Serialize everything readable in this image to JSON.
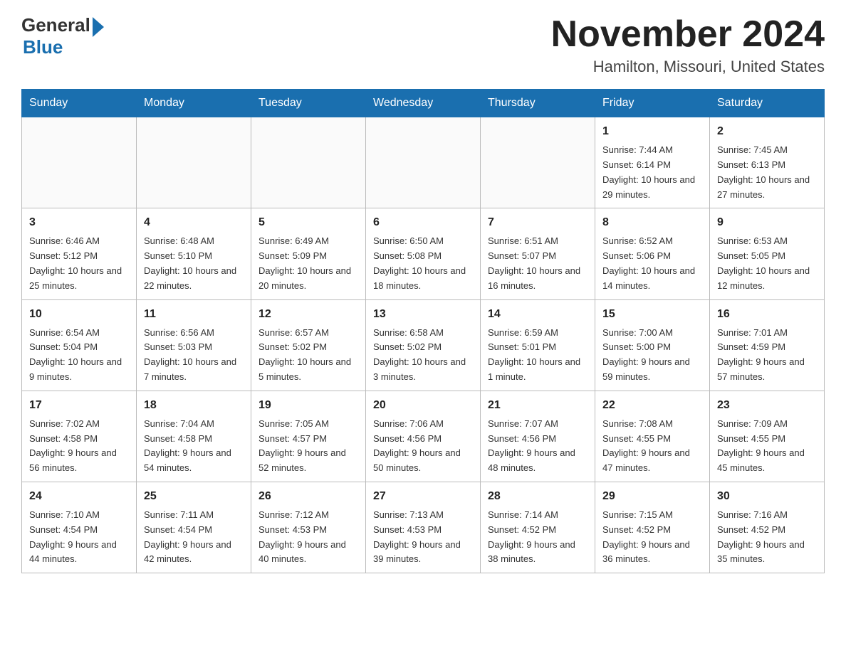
{
  "header": {
    "title": "November 2024",
    "subtitle": "Hamilton, Missouri, United States",
    "logo": {
      "general": "General",
      "blue": "Blue"
    }
  },
  "weekdays": [
    "Sunday",
    "Monday",
    "Tuesday",
    "Wednesday",
    "Thursday",
    "Friday",
    "Saturday"
  ],
  "weeks": [
    [
      {
        "day": "",
        "sunrise": "",
        "sunset": "",
        "daylight": ""
      },
      {
        "day": "",
        "sunrise": "",
        "sunset": "",
        "daylight": ""
      },
      {
        "day": "",
        "sunrise": "",
        "sunset": "",
        "daylight": ""
      },
      {
        "day": "",
        "sunrise": "",
        "sunset": "",
        "daylight": ""
      },
      {
        "day": "",
        "sunrise": "",
        "sunset": "",
        "daylight": ""
      },
      {
        "day": "1",
        "sunrise": "Sunrise: 7:44 AM",
        "sunset": "Sunset: 6:14 PM",
        "daylight": "Daylight: 10 hours and 29 minutes."
      },
      {
        "day": "2",
        "sunrise": "Sunrise: 7:45 AM",
        "sunset": "Sunset: 6:13 PM",
        "daylight": "Daylight: 10 hours and 27 minutes."
      }
    ],
    [
      {
        "day": "3",
        "sunrise": "Sunrise: 6:46 AM",
        "sunset": "Sunset: 5:12 PM",
        "daylight": "Daylight: 10 hours and 25 minutes."
      },
      {
        "day": "4",
        "sunrise": "Sunrise: 6:48 AM",
        "sunset": "Sunset: 5:10 PM",
        "daylight": "Daylight: 10 hours and 22 minutes."
      },
      {
        "day": "5",
        "sunrise": "Sunrise: 6:49 AM",
        "sunset": "Sunset: 5:09 PM",
        "daylight": "Daylight: 10 hours and 20 minutes."
      },
      {
        "day": "6",
        "sunrise": "Sunrise: 6:50 AM",
        "sunset": "Sunset: 5:08 PM",
        "daylight": "Daylight: 10 hours and 18 minutes."
      },
      {
        "day": "7",
        "sunrise": "Sunrise: 6:51 AM",
        "sunset": "Sunset: 5:07 PM",
        "daylight": "Daylight: 10 hours and 16 minutes."
      },
      {
        "day": "8",
        "sunrise": "Sunrise: 6:52 AM",
        "sunset": "Sunset: 5:06 PM",
        "daylight": "Daylight: 10 hours and 14 minutes."
      },
      {
        "day": "9",
        "sunrise": "Sunrise: 6:53 AM",
        "sunset": "Sunset: 5:05 PM",
        "daylight": "Daylight: 10 hours and 12 minutes."
      }
    ],
    [
      {
        "day": "10",
        "sunrise": "Sunrise: 6:54 AM",
        "sunset": "Sunset: 5:04 PM",
        "daylight": "Daylight: 10 hours and 9 minutes."
      },
      {
        "day": "11",
        "sunrise": "Sunrise: 6:56 AM",
        "sunset": "Sunset: 5:03 PM",
        "daylight": "Daylight: 10 hours and 7 minutes."
      },
      {
        "day": "12",
        "sunrise": "Sunrise: 6:57 AM",
        "sunset": "Sunset: 5:02 PM",
        "daylight": "Daylight: 10 hours and 5 minutes."
      },
      {
        "day": "13",
        "sunrise": "Sunrise: 6:58 AM",
        "sunset": "Sunset: 5:02 PM",
        "daylight": "Daylight: 10 hours and 3 minutes."
      },
      {
        "day": "14",
        "sunrise": "Sunrise: 6:59 AM",
        "sunset": "Sunset: 5:01 PM",
        "daylight": "Daylight: 10 hours and 1 minute."
      },
      {
        "day": "15",
        "sunrise": "Sunrise: 7:00 AM",
        "sunset": "Sunset: 5:00 PM",
        "daylight": "Daylight: 9 hours and 59 minutes."
      },
      {
        "day": "16",
        "sunrise": "Sunrise: 7:01 AM",
        "sunset": "Sunset: 4:59 PM",
        "daylight": "Daylight: 9 hours and 57 minutes."
      }
    ],
    [
      {
        "day": "17",
        "sunrise": "Sunrise: 7:02 AM",
        "sunset": "Sunset: 4:58 PM",
        "daylight": "Daylight: 9 hours and 56 minutes."
      },
      {
        "day": "18",
        "sunrise": "Sunrise: 7:04 AM",
        "sunset": "Sunset: 4:58 PM",
        "daylight": "Daylight: 9 hours and 54 minutes."
      },
      {
        "day": "19",
        "sunrise": "Sunrise: 7:05 AM",
        "sunset": "Sunset: 4:57 PM",
        "daylight": "Daylight: 9 hours and 52 minutes."
      },
      {
        "day": "20",
        "sunrise": "Sunrise: 7:06 AM",
        "sunset": "Sunset: 4:56 PM",
        "daylight": "Daylight: 9 hours and 50 minutes."
      },
      {
        "day": "21",
        "sunrise": "Sunrise: 7:07 AM",
        "sunset": "Sunset: 4:56 PM",
        "daylight": "Daylight: 9 hours and 48 minutes."
      },
      {
        "day": "22",
        "sunrise": "Sunrise: 7:08 AM",
        "sunset": "Sunset: 4:55 PM",
        "daylight": "Daylight: 9 hours and 47 minutes."
      },
      {
        "day": "23",
        "sunrise": "Sunrise: 7:09 AM",
        "sunset": "Sunset: 4:55 PM",
        "daylight": "Daylight: 9 hours and 45 minutes."
      }
    ],
    [
      {
        "day": "24",
        "sunrise": "Sunrise: 7:10 AM",
        "sunset": "Sunset: 4:54 PM",
        "daylight": "Daylight: 9 hours and 44 minutes."
      },
      {
        "day": "25",
        "sunrise": "Sunrise: 7:11 AM",
        "sunset": "Sunset: 4:54 PM",
        "daylight": "Daylight: 9 hours and 42 minutes."
      },
      {
        "day": "26",
        "sunrise": "Sunrise: 7:12 AM",
        "sunset": "Sunset: 4:53 PM",
        "daylight": "Daylight: 9 hours and 40 minutes."
      },
      {
        "day": "27",
        "sunrise": "Sunrise: 7:13 AM",
        "sunset": "Sunset: 4:53 PM",
        "daylight": "Daylight: 9 hours and 39 minutes."
      },
      {
        "day": "28",
        "sunrise": "Sunrise: 7:14 AM",
        "sunset": "Sunset: 4:52 PM",
        "daylight": "Daylight: 9 hours and 38 minutes."
      },
      {
        "day": "29",
        "sunrise": "Sunrise: 7:15 AM",
        "sunset": "Sunset: 4:52 PM",
        "daylight": "Daylight: 9 hours and 36 minutes."
      },
      {
        "day": "30",
        "sunrise": "Sunrise: 7:16 AM",
        "sunset": "Sunset: 4:52 PM",
        "daylight": "Daylight: 9 hours and 35 minutes."
      }
    ]
  ]
}
